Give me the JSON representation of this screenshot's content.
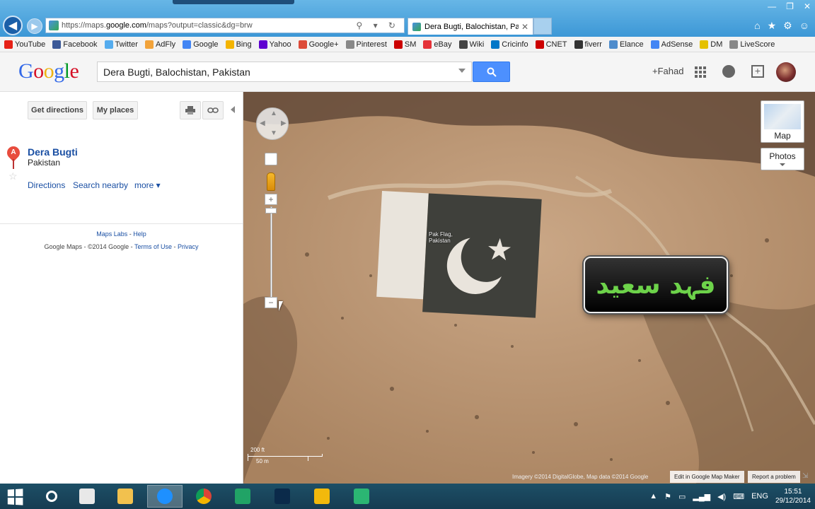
{
  "browser": {
    "url_prefix": "https://maps.",
    "url_domain": "google.com",
    "url_suffix": "/maps?output=classic&dg=brw",
    "tab_title": "Dera Bugti, Balochistan, Pa...",
    "tab_close": "✕",
    "addr_icons": "⚲ ▾ ↻",
    "window_controls": [
      "—",
      "❐",
      "✕"
    ],
    "toolbar_icons": [
      "⌂",
      "★",
      "⚙",
      "☺"
    ]
  },
  "favorites": [
    {
      "label": "YouTube",
      "color": "#e62117"
    },
    {
      "label": "Facebook",
      "color": "#3b5998"
    },
    {
      "label": "Twitter",
      "color": "#55acee"
    },
    {
      "label": "AdFly",
      "color": "#f2a33a"
    },
    {
      "label": "Google",
      "color": "#4285f4"
    },
    {
      "label": "Bing",
      "color": "#f4b400"
    },
    {
      "label": "Yahoo",
      "color": "#5f01d1"
    },
    {
      "label": "Google+",
      "color": "#dd4b39"
    },
    {
      "label": "Pinterest",
      "color": "#888888"
    },
    {
      "label": "SM",
      "color": "#cc0000"
    },
    {
      "label": "eBay",
      "color": "#e53238"
    },
    {
      "label": "Wiki",
      "color": "#444444"
    },
    {
      "label": "Cricinfo",
      "color": "#0077c8"
    },
    {
      "label": "CNET",
      "color": "#cc0000"
    },
    {
      "label": "fiverr",
      "color": "#333333"
    },
    {
      "label": "Elance",
      "color": "#4e8ccc"
    },
    {
      "label": "AdSense",
      "color": "#4285f4"
    },
    {
      "label": "DM",
      "color": "#e5c100"
    },
    {
      "label": "LiveScore",
      "color": "#888888"
    }
  ],
  "header": {
    "logo_letters": [
      {
        "ch": "G",
        "color": "#3369e8"
      },
      {
        "ch": "o",
        "color": "#d50f25"
      },
      {
        "ch": "o",
        "color": "#eeb211"
      },
      {
        "ch": "g",
        "color": "#3369e8"
      },
      {
        "ch": "l",
        "color": "#009925"
      },
      {
        "ch": "e",
        "color": "#d50f25"
      }
    ],
    "search_value": "Dera Bugti, Balochistan, Pakistan",
    "user_label": "+Fahad"
  },
  "leftpanel": {
    "get_directions": "Get directions",
    "my_places": "My places",
    "marker_letter": "A",
    "place_name": "Dera Bugti",
    "place_country": "Pakistan",
    "star": "☆",
    "links": {
      "directions": "Directions",
      "search_nearby": "Search nearby",
      "more": "more ▾"
    },
    "footer": {
      "maps_labs": "Maps Labs",
      "sep1": " - ",
      "help": "Help",
      "google_maps": "Google Maps",
      "copyright": " - ©2014 Google - ",
      "terms": "Terms of Use",
      "sep2": " - ",
      "privacy": "Privacy"
    }
  },
  "map": {
    "maptype_map": "Map",
    "maptype_photos": "Photos",
    "flag_label_1": "Pak Flag,",
    "flag_label_2": "Pakistan",
    "overlay_text": "فہد سعید",
    "scale_top": "200 ft",
    "scale_bottom": "50 m",
    "attribution": "Imagery ©2014 DigitalGlobe, Map data ©2014 Google",
    "edit_mapmaker": "Edit in Google Map Maker",
    "report_problem": "Report a problem"
  },
  "taskbar": {
    "apps": [
      {
        "name": "search",
        "color": "#ffffff"
      },
      {
        "name": "file-manager",
        "color": "#e8e8e8"
      },
      {
        "name": "explorer",
        "color": "#f2c14e"
      },
      {
        "name": "internet-explorer",
        "color": "#1e90ff"
      },
      {
        "name": "chrome",
        "color": "#34a853"
      },
      {
        "name": "store",
        "color": "#21a366"
      },
      {
        "name": "photoshop",
        "color": "#0b2a4a"
      },
      {
        "name": "media",
        "color": "#f2b90c"
      },
      {
        "name": "camtasia",
        "color": "#2bb673"
      }
    ],
    "lang": "ENG",
    "time": "15:51",
    "date": "29/12/2014"
  }
}
